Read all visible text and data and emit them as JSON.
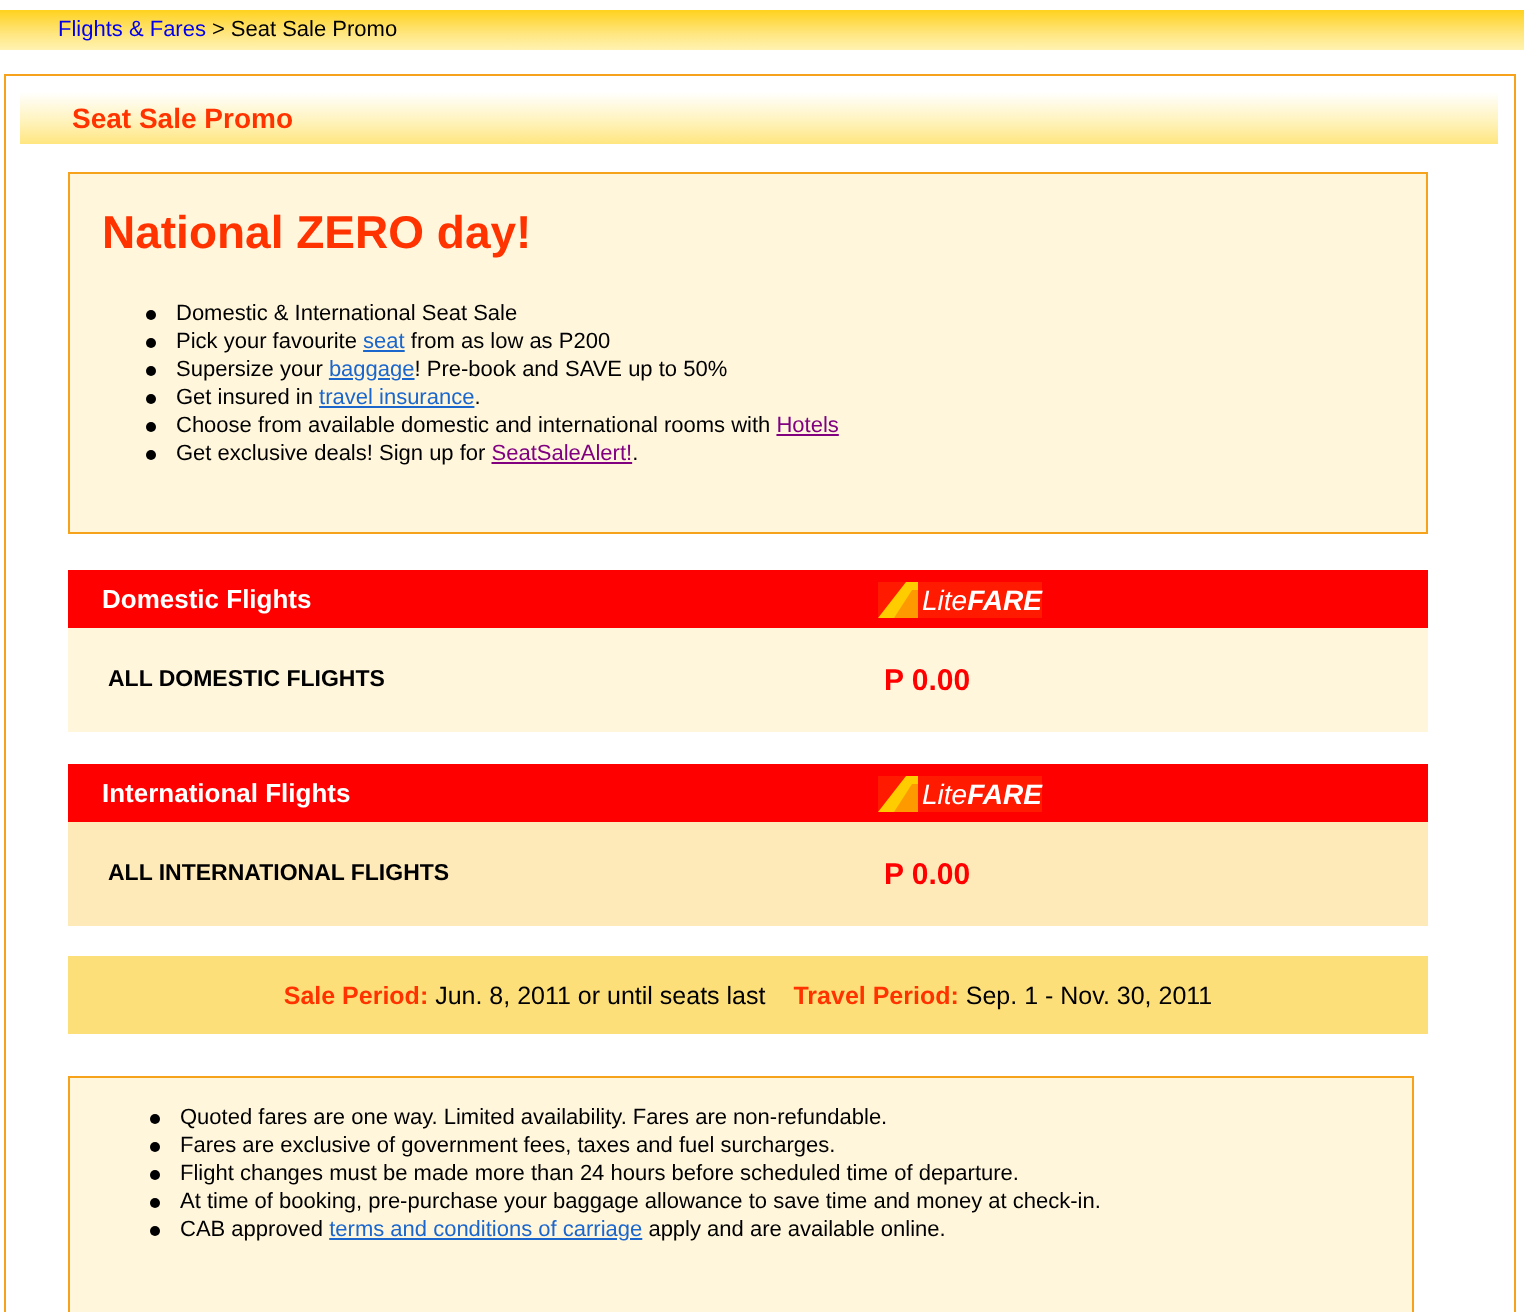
{
  "breadcrumb": {
    "link": "Flights & Fares",
    "separator": ">",
    "current": "Seat Sale Promo"
  },
  "page_title": "Seat Sale Promo",
  "promo": {
    "heading": "National ZERO day!",
    "items": [
      {
        "before": "Domestic & International Seat Sale"
      },
      {
        "before": "Pick your favourite ",
        "link": "seat",
        "visited": false,
        "after": " from as low as P200"
      },
      {
        "before": "Supersize your ",
        "link": "baggage",
        "visited": false,
        "after": "! Pre-book and SAVE up to 50%"
      },
      {
        "before": "Get insured in ",
        "link": "travel insurance",
        "visited": false,
        "after": "."
      },
      {
        "before": "Choose from available domestic and international rooms with ",
        "link": "Hotels",
        "visited": true
      },
      {
        "before": "Get exclusive deals! Sign up for ",
        "link": "SeatSaleAlert!",
        "visited": true,
        "after": "."
      }
    ]
  },
  "fares": [
    {
      "title": "Domestic Flights",
      "logo": {
        "light": "Lite",
        "bold": "FARE"
      },
      "route": "ALL DOMESTIC FLIGHTS",
      "price": "P 0.00",
      "color": "#fff6dc"
    },
    {
      "title": "International Flights",
      "logo": {
        "light": "Lite",
        "bold": "FARE"
      },
      "route": "ALL INTERNATIONAL FLIGHTS",
      "price": "P 0.00",
      "color": "#feeab8"
    }
  ],
  "periods": [
    {
      "label": "Sale Period:",
      "value": "Jun. 8, 2011 or until seats last"
    },
    {
      "label": "Travel Period:",
      "value": "Sep. 1 - Nov. 30, 2011"
    }
  ],
  "notes": [
    {
      "before": "Quoted fares are one way. Limited availability. Fares are non-refundable."
    },
    {
      "before": "Fares are exclusive of government fees, taxes and fuel surcharges."
    },
    {
      "before": "Flight changes must be made more than 24 hours before scheduled time of departure."
    },
    {
      "before": "At time of booking, pre-purchase your baggage allowance to save time and money at check-in."
    },
    {
      "before": "CAB approved ",
      "link": "terms and conditions of carriage",
      "visited": false,
      "after": " apply and are available online."
    }
  ]
}
